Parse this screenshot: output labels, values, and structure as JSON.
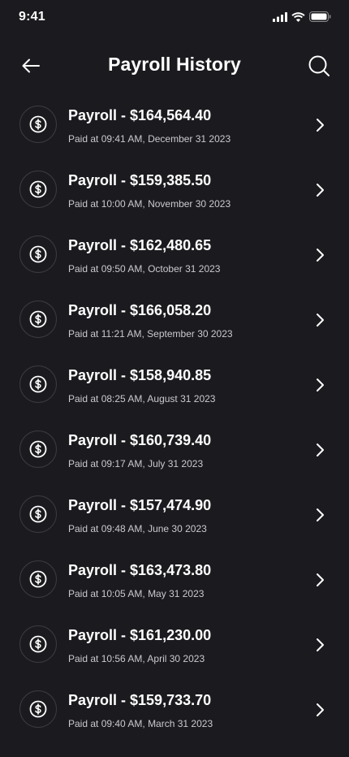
{
  "status_bar": {
    "time": "9:41"
  },
  "header": {
    "title": "Payroll History",
    "back_icon": "arrow-left-icon",
    "search_icon": "search-icon"
  },
  "payrolls": [
    {
      "title": "Payroll - $164,564.40",
      "subtitle": "Paid at 09:41 AM, December 31 2023"
    },
    {
      "title": "Payroll - $159,385.50",
      "subtitle": "Paid at 10:00 AM, November 30 2023"
    },
    {
      "title": "Payroll - $162,480.65",
      "subtitle": "Paid at 09:50 AM, October 31 2023"
    },
    {
      "title": "Payroll - $166,058.20",
      "subtitle": "Paid at 11:21 AM, September 30 2023"
    },
    {
      "title": "Payroll - $158,940.85",
      "subtitle": "Paid at 08:25 AM, August 31 2023"
    },
    {
      "title": "Payroll - $160,739.40",
      "subtitle": "Paid at 09:17 AM, July 31 2023"
    },
    {
      "title": "Payroll - $157,474.90",
      "subtitle": "Paid at 09:48 AM, June 30 2023"
    },
    {
      "title": "Payroll - $163,473.80",
      "subtitle": "Paid at 10:05 AM, May 31 2023"
    },
    {
      "title": "Payroll - $161,230.00",
      "subtitle": "Paid at 10:56 AM, April 30 2023"
    },
    {
      "title": "Payroll - $159,733.70",
      "subtitle": "Paid at 09:40 AM, March 31 2023"
    }
  ],
  "colors": {
    "background": "#1b1b1f",
    "text_primary": "#ffffff",
    "text_secondary": "#c9c9cf",
    "icon_border": "#3a3a40"
  }
}
